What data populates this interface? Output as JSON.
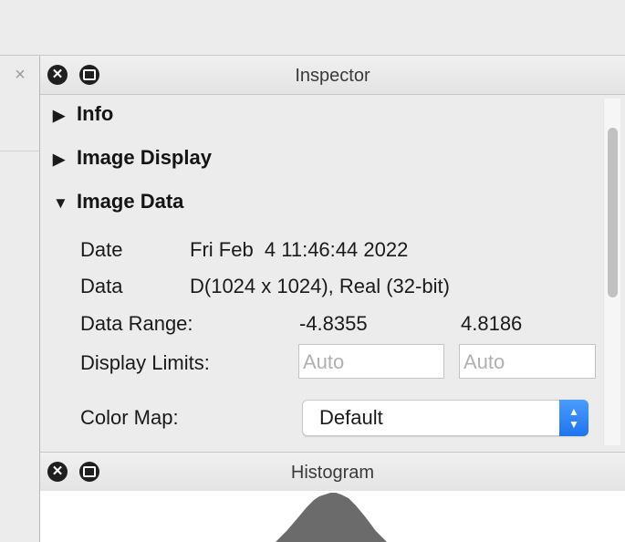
{
  "left_tab": {
    "close_glyph": "×"
  },
  "inspector": {
    "title": "Inspector",
    "close_glyph": "✕",
    "sections": [
      {
        "label": "Info",
        "expanded": false
      },
      {
        "label": "Image Display",
        "expanded": false
      },
      {
        "label": "Image Data",
        "expanded": true
      }
    ],
    "image_data": {
      "date_label": "Date",
      "date_value": "Fri Feb  4 11:46:44 2022",
      "data_label": "Data",
      "data_value": "D(1024 x 1024), Real (32-bit)",
      "range_label": "Data Range:",
      "range_min": "-4.8355",
      "range_max": "4.8186",
      "limits_label": "Display Limits:",
      "limit_low_placeholder": "Auto",
      "limit_high_placeholder": "Auto",
      "colormap_label": "Color Map:",
      "colormap_value": "Default"
    }
  },
  "histogram": {
    "title": "Histogram",
    "close_glyph": "✕"
  },
  "icons": {
    "collapsed": "▶",
    "expanded": "▼",
    "select_up": "▲",
    "select_down": "▼"
  },
  "colors": {
    "accent": "#1f73f0",
    "histogram_fill": "#6b6b6b"
  }
}
